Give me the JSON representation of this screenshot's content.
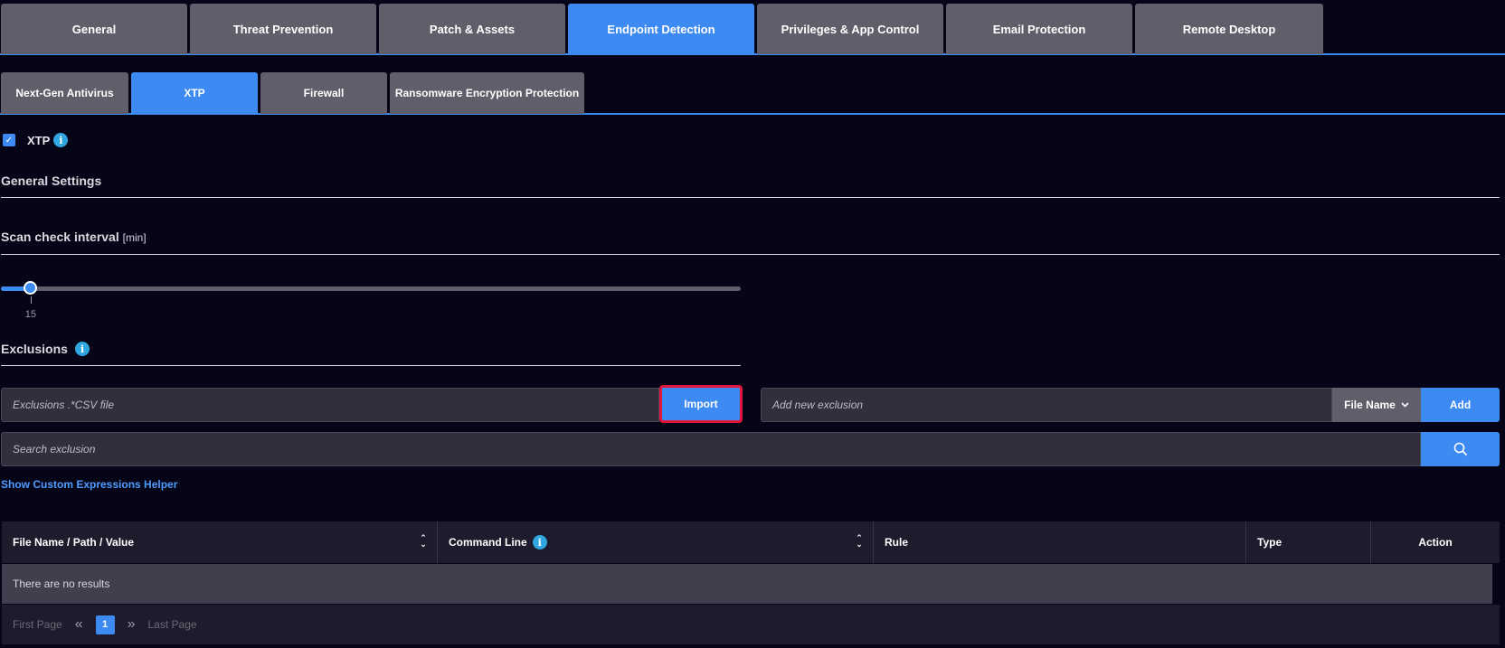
{
  "main_tabs": [
    {
      "label": "General"
    },
    {
      "label": "Threat Prevention"
    },
    {
      "label": "Patch & Assets"
    },
    {
      "label": "Endpoint Detection",
      "active": true
    },
    {
      "label": "Privileges & App Control"
    },
    {
      "label": "Email Protection"
    },
    {
      "label": "Remote Desktop"
    }
  ],
  "sub_tabs": [
    {
      "label": "Next-Gen Antivirus"
    },
    {
      "label": "XTP",
      "active": true
    },
    {
      "label": "Firewall"
    },
    {
      "label": "Ransomware Encryption Protection"
    }
  ],
  "xtp": {
    "label": "XTP",
    "checked": true,
    "check_mark": "✓",
    "info_glyph": "i"
  },
  "general_settings": {
    "title": "General Settings"
  },
  "scan_interval": {
    "title": "Scan check interval",
    "unit": "[min]",
    "value": "15",
    "level_fraction": 0.04
  },
  "exclusions": {
    "title": "Exclusions",
    "info_glyph": "i",
    "csv_placeholder": "Exclusions .*CSV file",
    "import_label": "Import",
    "new_placeholder": "Add new exclusion",
    "type_selected": "File Name",
    "add_label": "Add",
    "search_placeholder": "Search exclusion",
    "helper_link": "Show Custom Expressions Helper"
  },
  "table": {
    "columns": [
      "File Name / Path / Value",
      "Command Line",
      "Rule",
      "Type",
      "Action"
    ],
    "empty_text": "There are no results",
    "command_info_glyph": "i"
  },
  "pagination": {
    "first": "First Page",
    "prev_icon": "«",
    "current": "1",
    "next_icon": "»",
    "last": "Last Page"
  },
  "colors": {
    "accent": "#3d8bf2",
    "background": "#050517",
    "tab_inactive": "#5f5e6a",
    "highlight": "#e0153d"
  }
}
